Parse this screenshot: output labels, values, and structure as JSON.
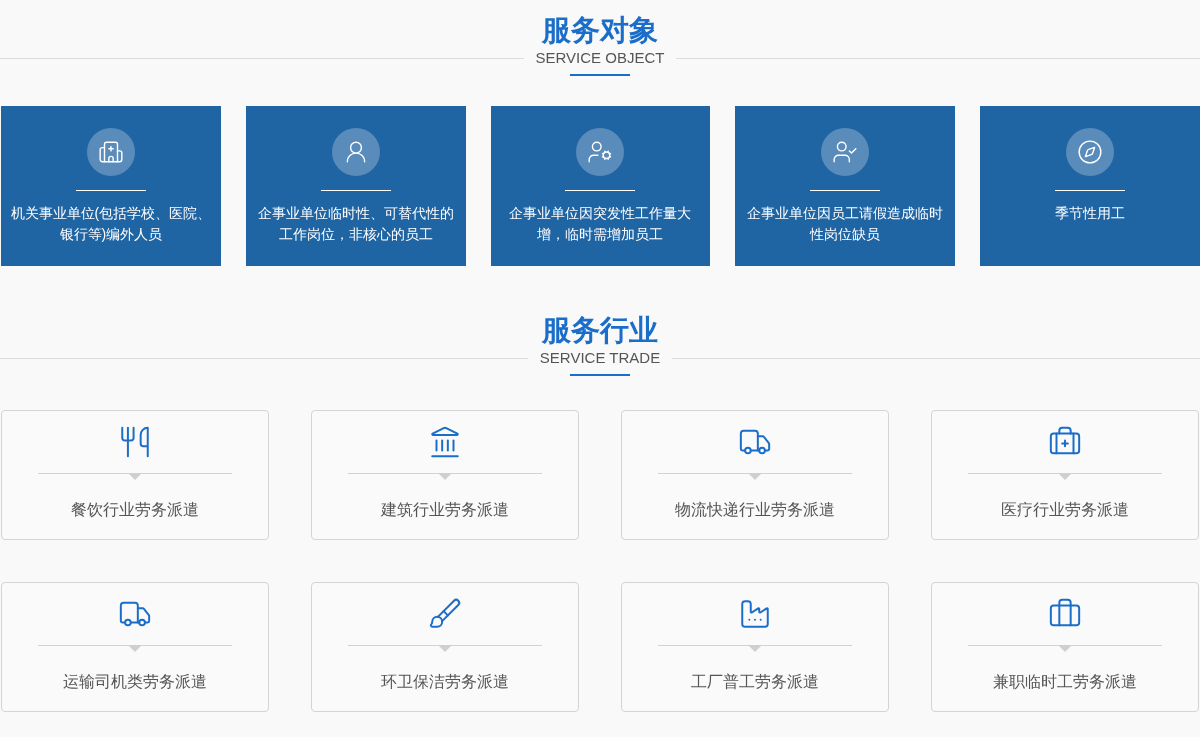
{
  "service_object": {
    "title": "服务对象",
    "subtitle": "SERVICE OBJECT",
    "cards": [
      {
        "text": "机关事业单位(包括学校、医院、银行等)编外人员"
      },
      {
        "text": "企事业单位临时性、可替代性的工作岗位，非核心的员工"
      },
      {
        "text": "企事业单位因突发性工作量大增，临时需增加员工"
      },
      {
        "text": "企事业单位因员工请假造成临时性岗位缺员"
      },
      {
        "text": "季节性用工"
      }
    ]
  },
  "service_trade": {
    "title": "服务行业",
    "subtitle": "SERVICE TRADE",
    "cards": [
      {
        "text": "餐饮行业劳务派遣"
      },
      {
        "text": "建筑行业劳务派遣"
      },
      {
        "text": "物流快递行业劳务派遣"
      },
      {
        "text": "医疗行业劳务派遣"
      },
      {
        "text": "运输司机类劳务派遣"
      },
      {
        "text": "环卫保洁劳务派遣"
      },
      {
        "text": "工厂普工劳务派遣"
      },
      {
        "text": "兼职临时工劳务派遣"
      }
    ]
  }
}
